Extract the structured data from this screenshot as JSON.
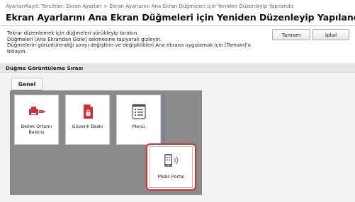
{
  "breadcrumb": "Ayarlar/Kayıt: Tercihler: Ekran Ayarları > Ekran Ayarlarını Ana Ekran Düğmeleri için Yeniden Düzenleyip Yapılandır",
  "title": "Ekran Ayarlarını Ana Ekran Düğmeleri için Yeniden Düzenleyip Yapılandır",
  "instructions": [
    "Tekrar düzenlemek için düğmeleri sürükleyip bırakın.",
    "Düğmeleri [Ana Ekrandan Gizle] sekmesine taşıyarak gizleyin.",
    "Düğmelerin görüntülendiği sırayı değiştirin ve değişiklikleri Ana ekrana uygulamak için [Tamam]'a",
    "tıklayın."
  ],
  "buttons": {
    "ok": "Tamam",
    "cancel": "İptal"
  },
  "section_title": "Düğme Görüntüleme Sırası",
  "tab_label": "Genel",
  "tiles": [
    {
      "label_line1": "Bellek Ortamı",
      "label_line2": "Baskısı",
      "icon": "usb-printer-icon"
    },
    {
      "label_line1": "Güvenli Baskı",
      "label_line2": "",
      "icon": "secure-document-icon"
    },
    {
      "label_line1": "Menü",
      "label_line2": "",
      "icon": "menu-list-icon"
    },
    {
      "label_line1": "Mobil Portal",
      "label_line2": "",
      "icon": "mobile-wireless-icon",
      "selected": true
    }
  ],
  "colors": {
    "accent_red": "#d0343a",
    "icon_red": "#c9353a",
    "grid_bg": "#8a8a8a"
  }
}
